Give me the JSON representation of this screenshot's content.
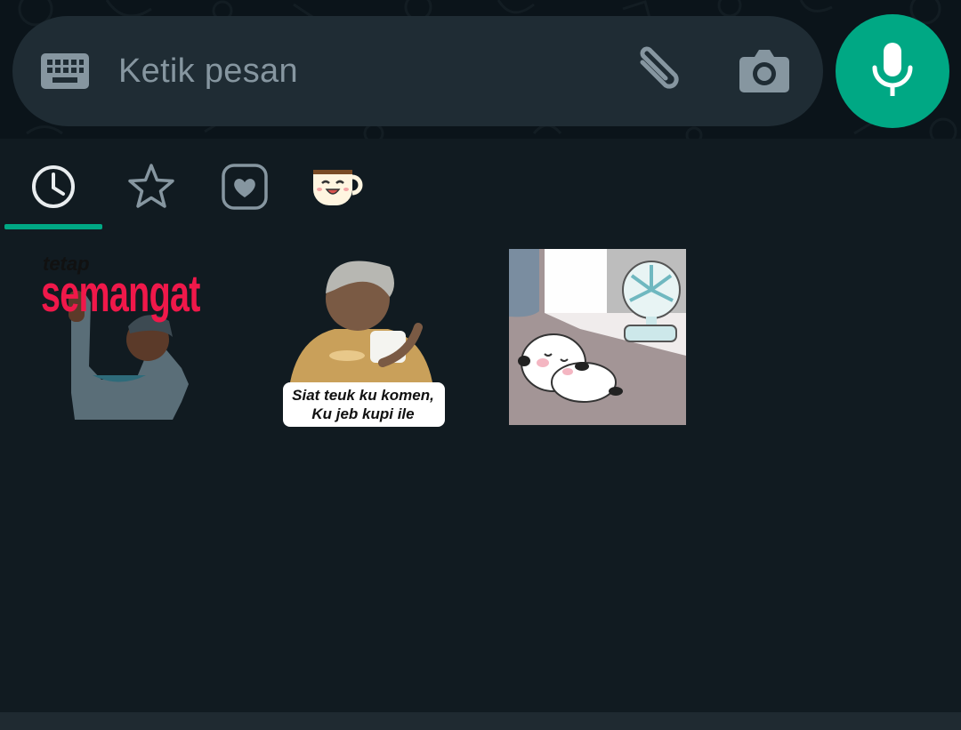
{
  "compose": {
    "placeholder": "Ketik pesan"
  },
  "icons": {
    "keyboard": "keyboard-icon",
    "attach": "paperclip-icon",
    "camera": "camera-icon",
    "mic": "microphone-icon"
  },
  "tabs": [
    {
      "name": "recent",
      "icon": "clock-icon",
      "selected": true
    },
    {
      "name": "favorites",
      "icon": "star-icon",
      "selected": false
    },
    {
      "name": "favorite-pack",
      "icon": "heart-icon",
      "selected": false
    },
    {
      "name": "coffee-pack",
      "icon": "coffee-cup-sticker-icon",
      "selected": false
    }
  ],
  "stickers": [
    {
      "line1": "tetap",
      "line2": "semangat"
    },
    {
      "line1": "Siat teuk ku komen,",
      "line2": "Ku jeb kupi ile"
    },
    {
      "desc": "panda-fan-sticker"
    }
  ],
  "colors": {
    "accent": "#00a884",
    "background": "#111b21",
    "compose": "#1f2c34"
  }
}
